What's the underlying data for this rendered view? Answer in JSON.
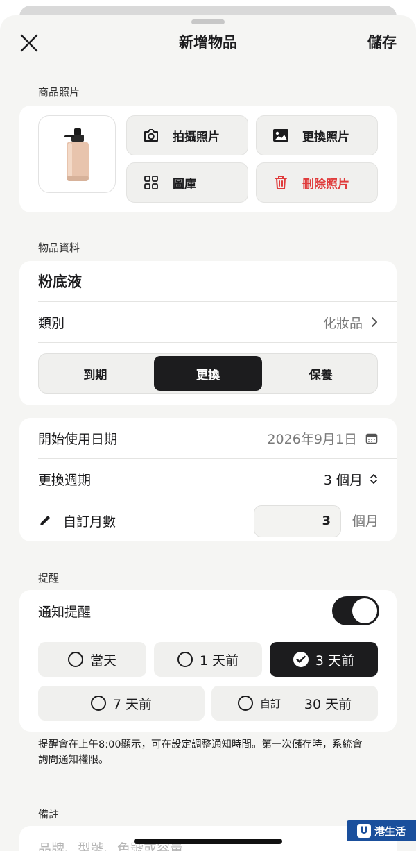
{
  "nav": {
    "title": "新增物品",
    "save_label": "儲存"
  },
  "photo_section": {
    "label": "商品照片",
    "buttons": [
      {
        "label": "拍攝照片",
        "icon": "camera-icon"
      },
      {
        "label": "更換照片",
        "icon": "image-icon"
      },
      {
        "label": "圖庫",
        "icon": "grid-icon"
      },
      {
        "label": "刪除照片",
        "icon": "trash-icon",
        "color": "#e03b3b"
      }
    ]
  },
  "info_section": {
    "label": "物品資料",
    "item_name": "粉底液",
    "category_label": "類別",
    "category_value": "化妝品",
    "segments": [
      "到期",
      "更換",
      "保養"
    ],
    "active_segment": "更換"
  },
  "dates": {
    "start_label": "開始使用日期",
    "start_value": "2026年9月1日",
    "cycle_label": "更換週期",
    "cycle_value": "3 個月",
    "custom_label": "自訂月數",
    "custom_value": "3",
    "custom_unit": "個月"
  },
  "reminder": {
    "label": "提醒",
    "toggle_label": "通知提醒",
    "toggle_on": true,
    "options": [
      "當天",
      "1 天前",
      "3 天前",
      "7 天前"
    ],
    "selected": "3 天前",
    "custom_prefix": "自訂",
    "custom_value": "30 天前",
    "hint": "提醒會在上午8:00顯示，可在設定調整通知時間。第一次儲存時，系統會詢問通知權限。"
  },
  "notes": {
    "label": "備註",
    "placeholder": "品牌、型號、色號或容量"
  },
  "watermark": "港生活",
  "colors": {
    "accent": "#1c1c1e",
    "danger": "#e03b3b",
    "background": "#f5f5f3"
  }
}
